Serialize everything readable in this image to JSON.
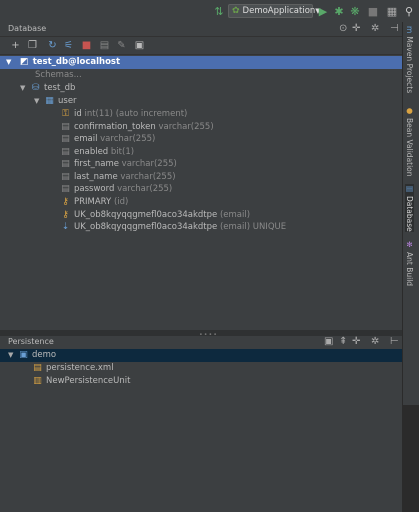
{
  "toolbar": {
    "run_config": "DemoApplication",
    "icons": [
      "build-icon",
      "run-icon",
      "debug-icon",
      "coverage-icon",
      "stop-icon",
      "project-structure-icon",
      "search-icon"
    ]
  },
  "database": {
    "title": "Database",
    "header_icons": [
      "settings-icon",
      "pin-icon",
      "gear-icon",
      "hide-icon"
    ],
    "tree": {
      "datasource": "test_db@localhost",
      "schemas": "Schemas...",
      "schema": "test_db",
      "table": "user",
      "columns": [
        {
          "name": "id",
          "type": "int(11) (auto increment)",
          "key": "primary"
        },
        {
          "name": "confirmation_token",
          "type": "varchar(255)",
          "key": "none"
        },
        {
          "name": "email",
          "type": "varchar(255)",
          "key": "none"
        },
        {
          "name": "enabled",
          "type": "bit(1)",
          "key": "none"
        },
        {
          "name": "first_name",
          "type": "varchar(255)",
          "key": "none"
        },
        {
          "name": "last_name",
          "type": "varchar(255)",
          "key": "none"
        },
        {
          "name": "password",
          "type": "varchar(255)",
          "key": "none"
        }
      ],
      "keys": [
        {
          "name": "PRIMARY",
          "detail": "(id)",
          "kind": "key"
        },
        {
          "name": "UK_ob8kqyqqgmefl0aco34akdtpe",
          "detail": "(email)",
          "kind": "key"
        },
        {
          "name": "UK_ob8kqyqqgmefl0aco34akdtpe",
          "detail": "(email) UNIQUE",
          "kind": "index"
        }
      ]
    }
  },
  "persistence": {
    "title": "Persistence",
    "root": "demo",
    "items": [
      "persistence.xml",
      "NewPersistenceUnit"
    ]
  },
  "right_tabs": [
    {
      "label": "Maven Projects",
      "icon": "maven-icon",
      "active": false
    },
    {
      "label": "Bean Validation",
      "icon": "bean-icon",
      "active": false
    },
    {
      "label": "Database",
      "icon": "database-icon",
      "active": true
    },
    {
      "label": "Ant Build",
      "icon": "ant-icon",
      "active": false
    }
  ],
  "colors": {
    "selection": "#4b6eaf",
    "panel": "#3c3f41",
    "run_green": "#59a869"
  }
}
